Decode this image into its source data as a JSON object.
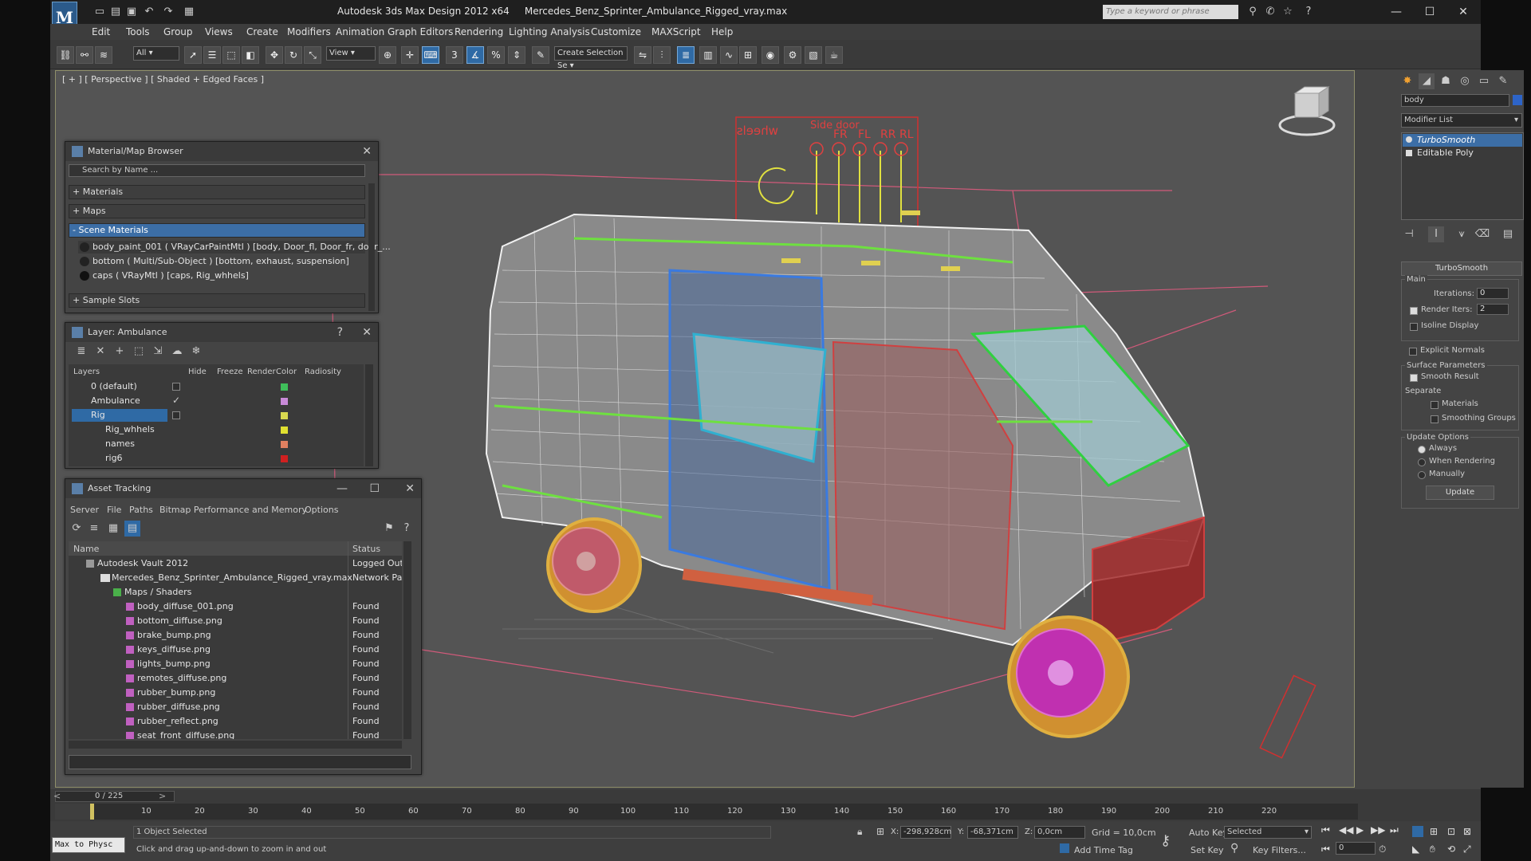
{
  "app": {
    "logo_text": "M",
    "title": "Autodesk 3ds Max Design 2012 x64",
    "file": "Mercedes_Benz_Sprinter_Ambulance_Rigged_vray.max",
    "search_placeholder": "Type a keyword or phrase"
  },
  "menu": [
    "Edit",
    "Tools",
    "Group",
    "Views",
    "Create",
    "Modifiers",
    "Animation",
    "Graph Editors",
    "Rendering",
    "Lighting Analysis",
    "Customize",
    "MAXScript",
    "Help"
  ],
  "toolbar": {
    "selection_filter": "All",
    "ref_coord": "View",
    "named_selection": "Create Selection Se",
    "snap_label": "3"
  },
  "viewport": {
    "label": "[ + ] [ Perspective ] [ Shaded + Edged Faces ]",
    "rig_labels": [
      "wheels",
      "Side door",
      "FR",
      "FL",
      "RR",
      "RL"
    ]
  },
  "material_browser": {
    "title": "Material/Map Browser",
    "search_placeholder": "Search by Name ...",
    "sections": {
      "materials": "+ Materials",
      "maps": "+ Maps",
      "scene": "- Scene Materials",
      "samples": "+ Sample Slots"
    },
    "scene_materials": [
      "body_paint_001 ( VRayCarPaintMtl ) [body, Door_fl, Door_fr, door_...",
      "bottom ( Multi/Sub-Object ) [bottom, exhaust, suspension]",
      "caps ( VRayMtl ) [caps, Rig_whhels]"
    ]
  },
  "layer": {
    "title": "Layer: Ambulance",
    "help": "?",
    "columns": [
      "Layers",
      "Hide",
      "Freeze",
      "Render",
      "Color",
      "Radiosity"
    ],
    "rows": [
      {
        "name": "0 (default)",
        "color": "#3fbf5a"
      },
      {
        "name": "Ambulance",
        "color": "#c88ad8"
      },
      {
        "name": "Rig",
        "color": "#d8d850"
      },
      {
        "name": "Rig_whhels",
        "color": "#e0e030"
      },
      {
        "name": "names",
        "color": "#e08060"
      },
      {
        "name": "rig6",
        "color": "#d02020"
      }
    ]
  },
  "assets": {
    "title": "Asset Tracking",
    "menu": [
      "Server",
      "File",
      "Paths",
      "Bitmap Performance and Memory",
      "Options"
    ],
    "columns": [
      "Name",
      "Status"
    ],
    "rows": [
      {
        "name": "Autodesk Vault 2012",
        "status": "Logged Out ..."
      },
      {
        "name": "Mercedes_Benz_Sprinter_Ambulance_Rigged_vray.max",
        "status": "Network Path"
      },
      {
        "name": "Maps / Shaders",
        "status": ""
      },
      {
        "name": "body_diffuse_001.png",
        "status": "Found"
      },
      {
        "name": "bottom_diffuse.png",
        "status": "Found"
      },
      {
        "name": "brake_bump.png",
        "status": "Found"
      },
      {
        "name": "keys_diffuse.png",
        "status": "Found"
      },
      {
        "name": "lights_bump.png",
        "status": "Found"
      },
      {
        "name": "remotes_diffuse.png",
        "status": "Found"
      },
      {
        "name": "rubber_bump.png",
        "status": "Found"
      },
      {
        "name": "rubber_diffuse.png",
        "status": "Found"
      },
      {
        "name": "rubber_reflect.png",
        "status": "Found"
      },
      {
        "name": "seat_front_diffuse.png",
        "status": "Found"
      }
    ]
  },
  "command_panel": {
    "object_name": "body",
    "modifier_list": "Modifier List",
    "stack": [
      "TurboSmooth",
      "Editable Poly"
    ],
    "rollout": "TurboSmooth",
    "main": "Main",
    "iterations_label": "Iterations:",
    "iterations": "0",
    "render_iters_label": "Render Iters:",
    "render_iters": "2",
    "isoline": "Isoline Display",
    "explicit": "Explicit Normals",
    "surface": "Surface Parameters",
    "smooth_result": "Smooth Result",
    "separate": "Separate",
    "materials": "Materials",
    "smoothing_groups": "Smoothing Groups",
    "update_options": "Update Options",
    "always": "Always",
    "when_rendering": "When Rendering",
    "manually": "Manually",
    "update": "Update"
  },
  "timeline": {
    "frame": "0 / 225",
    "ticks": [
      "10",
      "20",
      "30",
      "40",
      "50",
      "60",
      "70",
      "80",
      "90",
      "100",
      "110",
      "120",
      "130",
      "140",
      "150",
      "160",
      "170",
      "180",
      "190",
      "200",
      "210",
      "220"
    ]
  },
  "status": {
    "maxscript": "Max to Physc",
    "selected": "1 Object Selected",
    "prompt": "Click and drag up-and-down to zoom in and out",
    "x_label": "X:",
    "x": "-298,928cm",
    "y_label": "Y:",
    "y": "-68,371cm",
    "z_label": "Z:",
    "z": "0,0cm",
    "grid": "Grid = 10,0cm",
    "add_time_tag": "Add Time Tag",
    "auto_key": "Auto Key",
    "selected_dd": "Selected",
    "set_key": "Set Key",
    "key_filters": "Key Filters...",
    "frame_field": "0"
  }
}
